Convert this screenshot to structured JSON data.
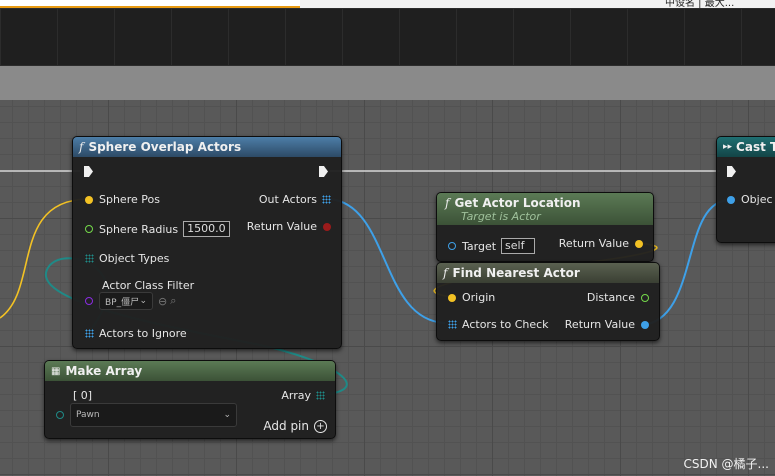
{
  "topbar": {
    "right_text": "中设名 | 最大..."
  },
  "nodes": {
    "sphere_overlap": {
      "title": "Sphere Overlap Actors",
      "fx": "f",
      "pins": {
        "sphere_pos": "Sphere Pos",
        "sphere_radius": "Sphere Radius",
        "sphere_radius_value": "1500.0",
        "object_types": "Object Types",
        "actor_class_filter": "Actor Class Filter",
        "actor_class_value": "BP_僵尸",
        "actors_to_ignore": "Actors to Ignore",
        "out_actors": "Out Actors",
        "return_value": "Return Value"
      }
    },
    "get_actor_location": {
      "title": "Get Actor Location",
      "subtitle": "Target is Actor",
      "fx": "f",
      "pins": {
        "target": "Target",
        "target_value": "self",
        "return_value": "Return Value"
      }
    },
    "find_nearest": {
      "title": "Find Nearest Actor",
      "fx": "f",
      "pins": {
        "origin": "Origin",
        "actors_to_check": "Actors to Check",
        "distance": "Distance",
        "return_value": "Return Value"
      }
    },
    "cast": {
      "title": "Cast T",
      "pins": {
        "object": "Objec"
      }
    },
    "make_array": {
      "title": "Make Array",
      "pins": {
        "index": "[ 0]",
        "element_value": "Pawn",
        "array": "Array",
        "add_pin": "Add pin"
      }
    }
  },
  "colors": {
    "exec": "#f0f0f0",
    "vector": "#f3c224",
    "float": "#74d94a",
    "object": "#3ea0e8",
    "class": "#8a2be2",
    "bool": "#9b1b1b",
    "struct": "#1f8a87"
  },
  "watermark": "CSDN @橘子..."
}
